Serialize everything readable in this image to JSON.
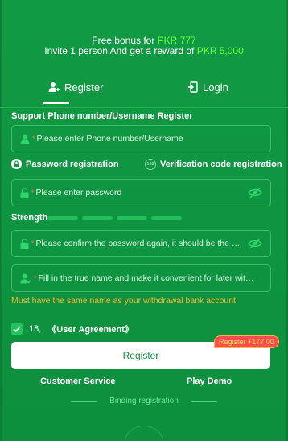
{
  "bonus": {
    "line1_prefix": "Free bonus for ",
    "line1_amount": "PKR 777",
    "line2_prefix": "Invite 1 person And get a reward of ",
    "line2_amount": "PKR 5,000"
  },
  "tabs": [
    {
      "label": "Register",
      "icon": "user-plus-icon",
      "active": true
    },
    {
      "label": "Login",
      "icon": "login-door-icon",
      "active": false
    }
  ],
  "form": {
    "support_label": "Support Phone number/Username Register",
    "phone_placeholder": "Please enter Phone number/Username",
    "option_password": "Password registration",
    "option_code": "Verification code registration",
    "option_code_icon_text": "123",
    "password_placeholder": "Please enter password",
    "strength_label": "Strength",
    "strength_bars": 4,
    "confirm_placeholder": "Please confirm the password again, it should be the same as above",
    "name_placeholder": "Fill in the true name and make it convenient for later withdrawal",
    "required_mark": "*",
    "warning": "Must have the same name as your withdrawal bank account"
  },
  "agreement": {
    "checked": true,
    "age": "18,",
    "label": "《User Agreement》"
  },
  "register_button": {
    "label": "Register",
    "badge": "Register +177.00"
  },
  "links": {
    "customer_service": "Customer Service",
    "play_demo": "Play Demo",
    "binding": "Binding registration"
  },
  "colors": {
    "background": "#0f9440",
    "highlight": "#6bff3c",
    "warning": "#f7b731",
    "badge": "#ff4d4f"
  }
}
